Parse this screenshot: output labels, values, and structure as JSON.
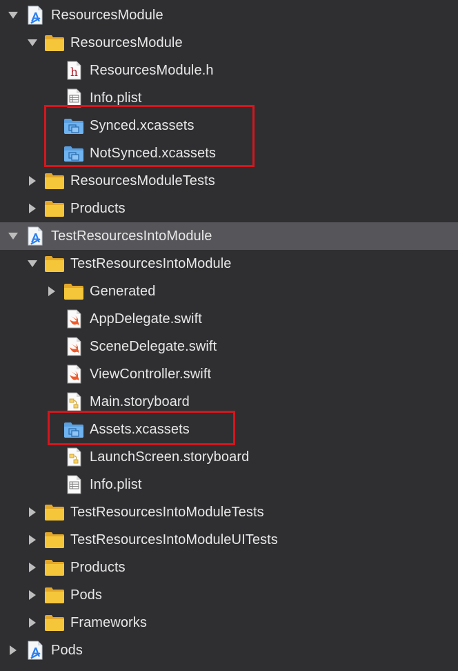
{
  "navigator": {
    "rows": [
      {
        "label": "ResourcesModule",
        "icon": "xcode-project-icon",
        "disclosure": "expanded"
      },
      {
        "label": "ResourcesModule",
        "icon": "folder-icon",
        "disclosure": "expanded"
      },
      {
        "label": "ResourcesModule.h",
        "icon": "header-file-icon",
        "disclosure": "none"
      },
      {
        "label": "Info.plist",
        "icon": "plist-file-icon",
        "disclosure": "none"
      },
      {
        "label": "Synced.xcassets",
        "icon": "asset-catalog-icon",
        "disclosure": "none"
      },
      {
        "label": "NotSynced.xcassets",
        "icon": "asset-catalog-icon",
        "disclosure": "none"
      },
      {
        "label": "ResourcesModuleTests",
        "icon": "folder-icon",
        "disclosure": "collapsed"
      },
      {
        "label": "Products",
        "icon": "folder-icon",
        "disclosure": "collapsed"
      },
      {
        "label": "TestResourcesIntoModule",
        "icon": "xcode-project-icon",
        "disclosure": "expanded",
        "selected": true
      },
      {
        "label": "TestResourcesIntoModule",
        "icon": "folder-icon",
        "disclosure": "expanded"
      },
      {
        "label": "Generated",
        "icon": "folder-icon",
        "disclosure": "collapsed"
      },
      {
        "label": "AppDelegate.swift",
        "icon": "swift-file-icon",
        "disclosure": "none"
      },
      {
        "label": "SceneDelegate.swift",
        "icon": "swift-file-icon",
        "disclosure": "none"
      },
      {
        "label": "ViewController.swift",
        "icon": "swift-file-icon",
        "disclosure": "none"
      },
      {
        "label": "Main.storyboard",
        "icon": "storyboard-file-icon",
        "disclosure": "none"
      },
      {
        "label": "Assets.xcassets",
        "icon": "asset-catalog-icon",
        "disclosure": "none"
      },
      {
        "label": "LaunchScreen.storyboard",
        "icon": "storyboard-file-icon",
        "disclosure": "none"
      },
      {
        "label": "Info.plist",
        "icon": "plist-file-icon",
        "disclosure": "none"
      },
      {
        "label": "TestResourcesIntoModuleTests",
        "icon": "folder-icon",
        "disclosure": "collapsed"
      },
      {
        "label": "TestResourcesIntoModuleUITests",
        "icon": "folder-icon",
        "disclosure": "collapsed"
      },
      {
        "label": "Products",
        "icon": "folder-icon",
        "disclosure": "collapsed"
      },
      {
        "label": "Pods",
        "icon": "folder-icon",
        "disclosure": "collapsed"
      },
      {
        "label": "Frameworks",
        "icon": "folder-icon",
        "disclosure": "collapsed"
      },
      {
        "label": "Pods",
        "icon": "xcode-project-icon",
        "disclosure": "collapsed"
      }
    ]
  },
  "colors": {
    "background": "#2f2f32",
    "selected_row": "#56565a",
    "highlight_box": "#d4161d",
    "folder": "#f5c63a",
    "asset_catalog": "#6fb3f0"
  }
}
